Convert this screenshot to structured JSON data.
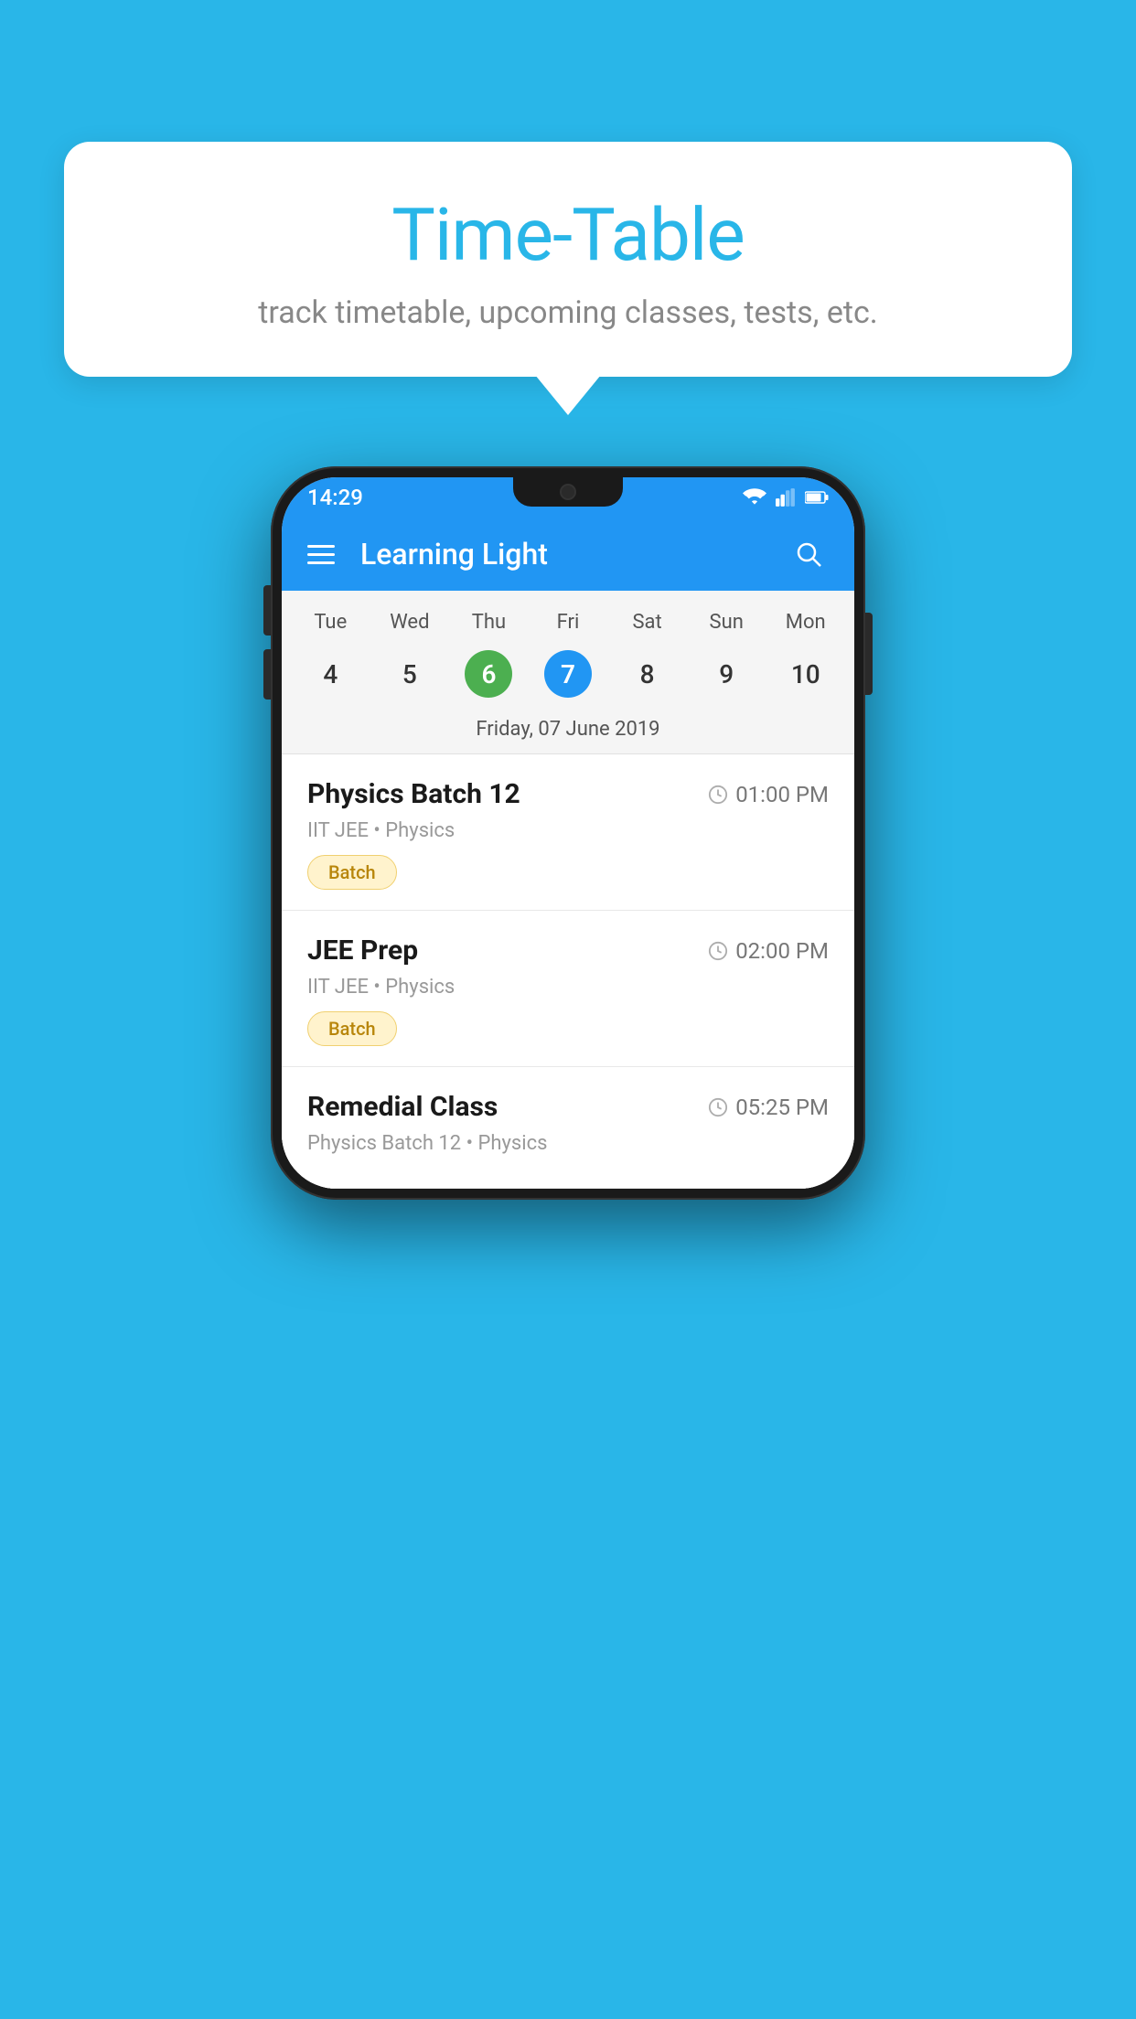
{
  "background": {
    "color": "#29b6e8"
  },
  "speech_bubble": {
    "title": "Time-Table",
    "subtitle": "track timetable, upcoming classes, tests, etc."
  },
  "phone": {
    "status_bar": {
      "time": "14:29"
    },
    "app_bar": {
      "title": "Learning Light"
    },
    "calendar": {
      "days": [
        {
          "short": "Tue",
          "num": "4"
        },
        {
          "short": "Wed",
          "num": "5"
        },
        {
          "short": "Thu",
          "num": "6",
          "highlight": "green"
        },
        {
          "short": "Fri",
          "num": "7",
          "highlight": "blue"
        },
        {
          "short": "Sat",
          "num": "8"
        },
        {
          "short": "Sun",
          "num": "9"
        },
        {
          "short": "Mon",
          "num": "10"
        }
      ],
      "selected_date_label": "Friday, 07 June 2019"
    },
    "schedule": [
      {
        "title": "Physics Batch 12",
        "time": "01:00 PM",
        "subtitle": "IIT JEE • Physics",
        "tag": "Batch"
      },
      {
        "title": "JEE Prep",
        "time": "02:00 PM",
        "subtitle": "IIT JEE • Physics",
        "tag": "Batch"
      },
      {
        "title": "Remedial Class",
        "time": "05:25 PM",
        "subtitle": "Physics Batch 12 • Physics",
        "tag": null
      }
    ]
  }
}
